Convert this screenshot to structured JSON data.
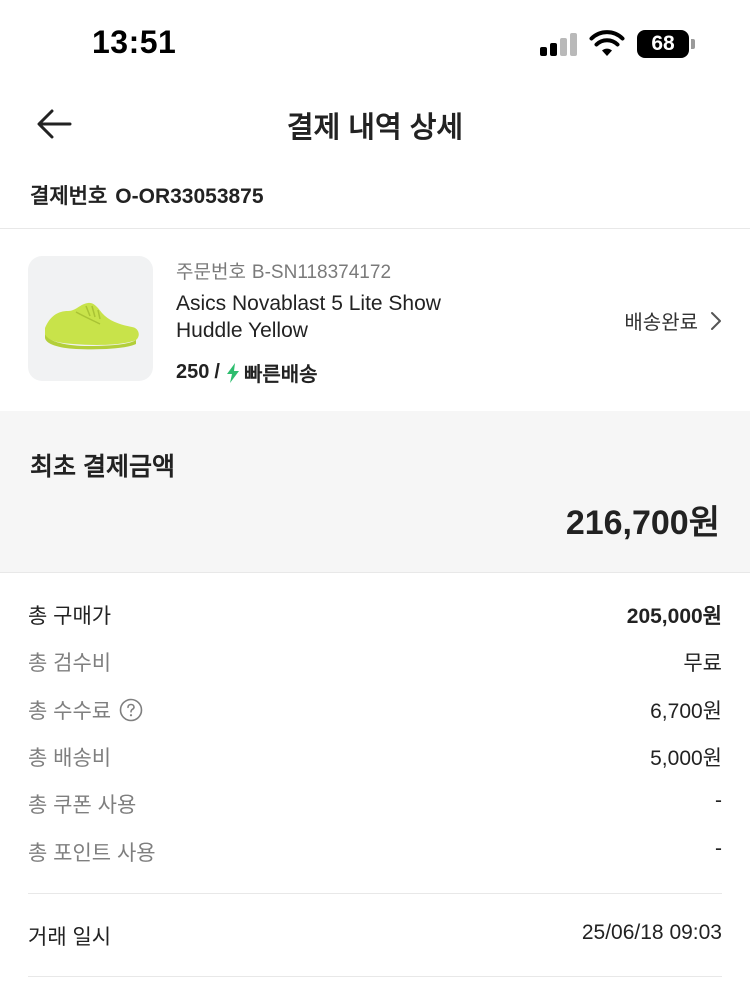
{
  "status_bar": {
    "time": "13:51",
    "battery": "68"
  },
  "header": {
    "title": "결제 내역 상세",
    "back_icon": "arrow-left-icon"
  },
  "payment": {
    "label": "결제번호",
    "number": "O-OR33053875"
  },
  "product": {
    "order_label": "주문번호",
    "order_number": "B-SN118374172",
    "name": "Asics Novablast 5 Lite Show Huddle Yellow",
    "size": "250",
    "separator": "/",
    "delivery_icon": "lightning-bolt-icon",
    "delivery_type": "빠른배송",
    "status": "배송완료",
    "shoe_color": "#c8e34a"
  },
  "total": {
    "label": "최초 결제금액",
    "amount": "216,700원"
  },
  "breakdown": [
    {
      "label": "총 구매가",
      "value": "205,000원"
    },
    {
      "label": "총 검수비",
      "value": "무료"
    },
    {
      "label": "총 수수료",
      "value": "6,700원"
    },
    {
      "label": "총 배송비",
      "value": "5,000원"
    },
    {
      "label": "총 쿠폰 사용",
      "value": "-"
    },
    {
      "label": "총 포인트 사용",
      "value": "-"
    }
  ],
  "transaction": {
    "label": "거래 일시",
    "value": "25/06/18 09:03"
  },
  "colors": {
    "accent_green": "#2dbd6e",
    "text": "#222222",
    "muted": "#7f7f7f"
  }
}
